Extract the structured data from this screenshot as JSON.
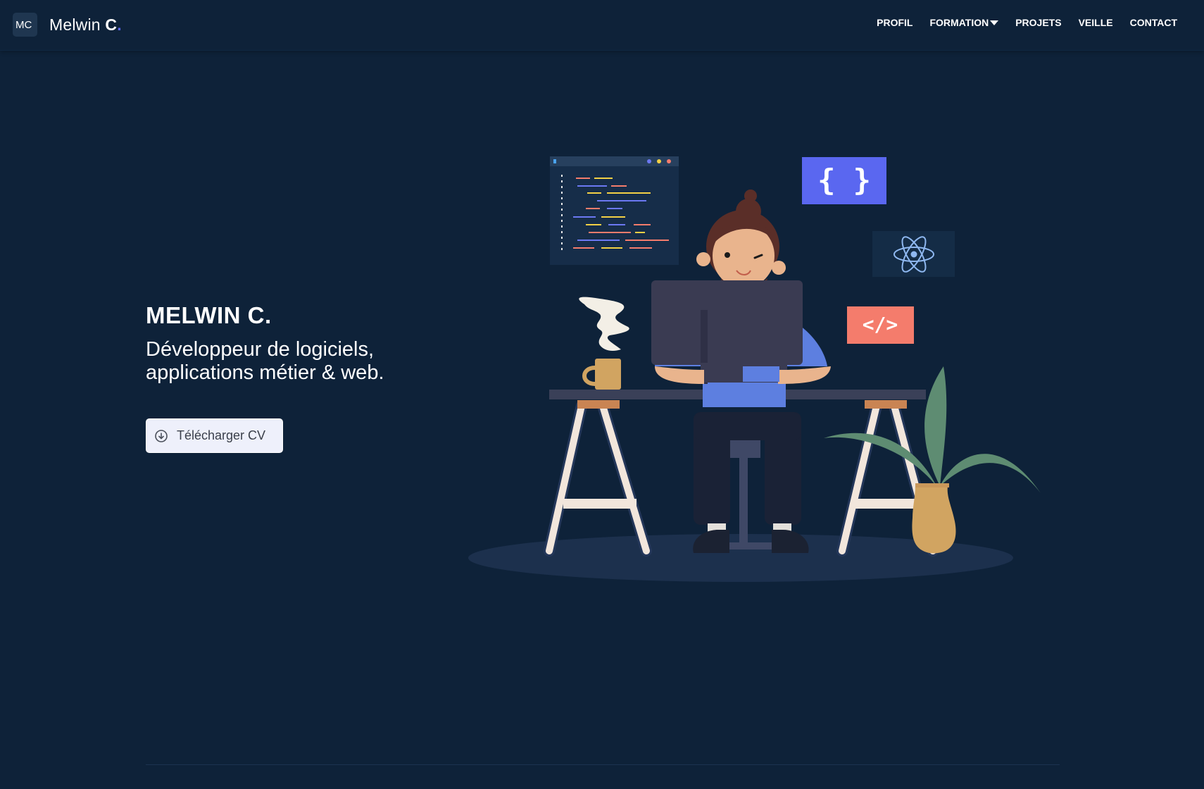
{
  "header": {
    "logo_text": "MC",
    "brand_first": "Melwin ",
    "brand_bold": "C",
    "brand_dot": ".",
    "nav": [
      {
        "label": "PROFIL"
      },
      {
        "label": "FORMATION"
      },
      {
        "label": "PROJETS"
      },
      {
        "label": "VEILLE"
      },
      {
        "label": "CONTACT"
      }
    ]
  },
  "hero": {
    "title": "MELWIN C.",
    "subtitle_line1": "Développeur de logiciels,",
    "subtitle_line2": "applications métier & web.",
    "cv_button": "Télécharger CV"
  },
  "illustration": {
    "icons": [
      "code-editor-window",
      "curly-braces-icon",
      "react-atom-icon",
      "html-tag-icon",
      "coffee-mug",
      "plant"
    ],
    "braces_text": "{ }",
    "tag_text": "</>"
  },
  "colors": {
    "background": "#0e2239",
    "accent": "#5a67f0",
    "tag_red": "#f47c6c",
    "plant_green": "#5e8c72",
    "mug_tan": "#d1a461"
  }
}
